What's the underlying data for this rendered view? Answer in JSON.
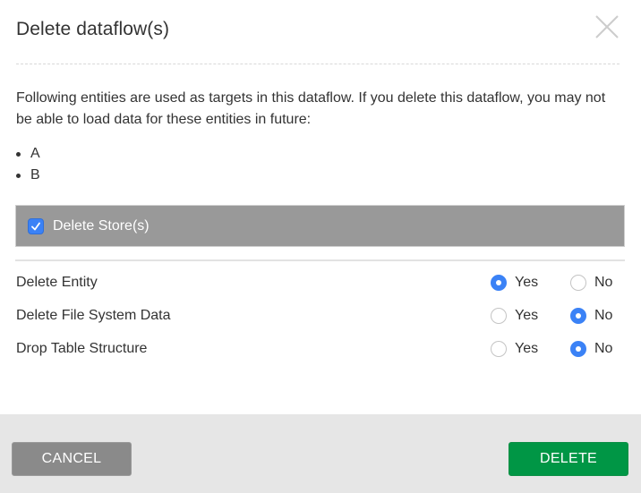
{
  "dialog": {
    "title": "Delete dataflow(s)",
    "close_icon": "close-icon",
    "message": "Following entities are used as targets in this dataflow. If you delete this dataflow, you may not be able to load data for these entities in future:",
    "entities": [
      "A",
      "B"
    ],
    "delete_store": {
      "label": "Delete Store(s)",
      "checked": true
    },
    "options": [
      {
        "label": "Delete Entity",
        "yes_label": "Yes",
        "no_label": "No",
        "selected": "Yes"
      },
      {
        "label": "Delete File System Data",
        "yes_label": "Yes",
        "no_label": "No",
        "selected": "No"
      },
      {
        "label": "Drop Table Structure",
        "yes_label": "Yes",
        "no_label": "No",
        "selected": "No"
      }
    ],
    "buttons": {
      "cancel": "CANCEL",
      "delete": "DELETE"
    },
    "colors": {
      "accent_blue": "#3b82f6",
      "delete_green": "#009645",
      "cancel_gray": "#8a8a8a",
      "store_bar_gray": "#999999",
      "footer_bg": "#e6e6e6"
    }
  }
}
